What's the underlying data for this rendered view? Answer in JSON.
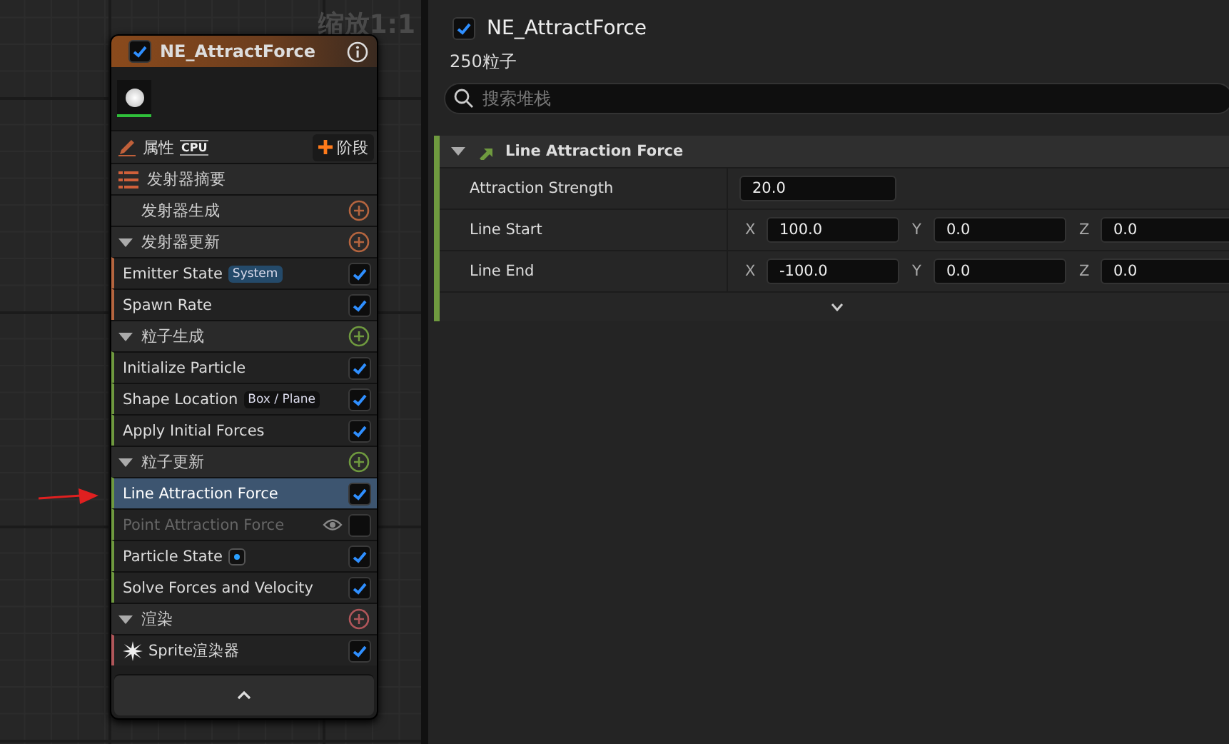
{
  "graph": {
    "zoom_label": "缩放1:1",
    "node": {
      "title": "NE_AttractForce",
      "enabled": true,
      "properties": {
        "label": "属性",
        "sim_target": "CPU",
        "add_stage": "阶段"
      },
      "sections": [
        {
          "kind": "summary",
          "label": "发射器摘要"
        },
        {
          "kind": "plain",
          "label": "发射器生成",
          "color": "#b5653f"
        },
        {
          "kind": "group",
          "label": "发射器更新",
          "color": "#b5653f",
          "expanded": true,
          "modules": [
            {
              "kind": "text",
              "label": "Emitter State",
              "badge": {
                "text": "System",
                "color": "#244a6a"
              },
              "enabled": true,
              "selected": false
            },
            {
              "kind": "text",
              "label": "Spawn Rate",
              "enabled": true,
              "selected": false
            }
          ]
        },
        {
          "kind": "group",
          "label": "粒子生成",
          "color": "#6f9a3f",
          "expanded": true,
          "modules": [
            {
              "kind": "text",
              "label": "Initialize Particle",
              "enabled": true,
              "selected": false
            },
            {
              "kind": "text",
              "label": "Shape Location",
              "badge": {
                "text": "Box / Plane",
                "color": "#111111"
              },
              "enabled": true,
              "selected": false
            },
            {
              "kind": "text",
              "label": "Apply Initial Forces",
              "enabled": true,
              "selected": false
            }
          ]
        },
        {
          "kind": "group",
          "label": "粒子更新",
          "color": "#6f9a3f",
          "expanded": true,
          "modules": [
            {
              "kind": "text",
              "label": "Line Attraction Force",
              "enabled": true,
              "selected": true
            },
            {
              "kind": "text",
              "label": "Point Attraction Force",
              "enabled": false,
              "selected": false
            },
            {
              "kind": "dot",
              "label": "Particle State",
              "enabled": true,
              "selected": false
            },
            {
              "kind": "text",
              "label": "Solve Forces and Velocity",
              "enabled": true,
              "selected": false
            }
          ]
        },
        {
          "kind": "group",
          "label": "渲染",
          "color": "#b0565a",
          "expanded": true,
          "modules": [
            {
              "kind": "renderer",
              "label": "Sprite渲染器",
              "enabled": true,
              "selected": false
            }
          ]
        }
      ]
    }
  },
  "details": {
    "title": "NE_AttractForce",
    "enabled": true,
    "particle_count": "250粒子",
    "search": {
      "placeholder": "搜索堆栈"
    },
    "section": {
      "title": "Line Attraction Force",
      "expanded": true,
      "rows": [
        {
          "kind": "scalar",
          "label": "Attraction Strength",
          "value": "20.0"
        },
        {
          "kind": "vector",
          "label": "Line Start",
          "axes": [
            {
              "axis": "X",
              "value": "100.0"
            },
            {
              "axis": "Y",
              "value": "0.0"
            },
            {
              "axis": "Z",
              "value": "0.0"
            }
          ]
        },
        {
          "kind": "vector",
          "label": "Line End",
          "axes": [
            {
              "axis": "X",
              "value": "-100.0"
            },
            {
              "axis": "Y",
              "value": "0.0"
            },
            {
              "axis": "Z",
              "value": "0.0"
            }
          ]
        }
      ]
    }
  }
}
